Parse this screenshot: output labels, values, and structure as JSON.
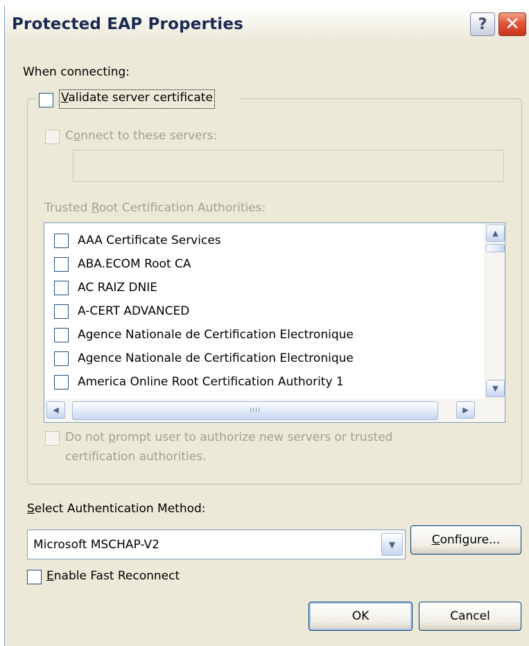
{
  "dialog": {
    "title": "Protected EAP Properties",
    "help_glyph": "?",
    "close_glyph": "✕"
  },
  "when_connecting_label": "When connecting:",
  "validate_cert": {
    "prefix": "",
    "mnemonic": "V",
    "rest": "alidate server certificate",
    "checked": false
  },
  "connect_servers": {
    "prefix": "C",
    "mnemonic": "o",
    "rest": "nnect to these servers:",
    "checked": false,
    "enabled": false,
    "value": ""
  },
  "trusted_root": {
    "prefix": "Trusted ",
    "mnemonic": "R",
    "rest": "oot Certification Authorities:",
    "items": [
      {
        "label": "AAA Certificate Services",
        "checked": false
      },
      {
        "label": "ABA.ECOM Root CA",
        "checked": false
      },
      {
        "label": "AC RAIZ DNIE",
        "checked": false
      },
      {
        "label": "A-CERT ADVANCED",
        "checked": false
      },
      {
        "label": "Agence Nationale de Certification Electronique",
        "checked": false
      },
      {
        "label": "Agence Nationale de Certification Electronique",
        "checked": false
      },
      {
        "label": "America Online Root Certification Authority 1",
        "checked": false
      }
    ],
    "hscroll_grip": "IIII"
  },
  "no_prompt": {
    "line1_prefix": "Do not ",
    "line1_mnemonic": "p",
    "line1_rest": "rompt user to authorize new servers or trusted",
    "line2": "certification authorities.",
    "checked": false,
    "enabled": false
  },
  "auth_method": {
    "label_mnemonic": "S",
    "label_rest": "elect Authentication Method:",
    "selected": "Microsoft MSCHAP-V2"
  },
  "configure_button": {
    "mnemonic": "C",
    "rest": "onfigure..."
  },
  "fast_reconnect": {
    "mnemonic": "E",
    "rest": "nable Fast Reconnect",
    "checked": false
  },
  "ok_button": "OK",
  "cancel_button": "Cancel"
}
